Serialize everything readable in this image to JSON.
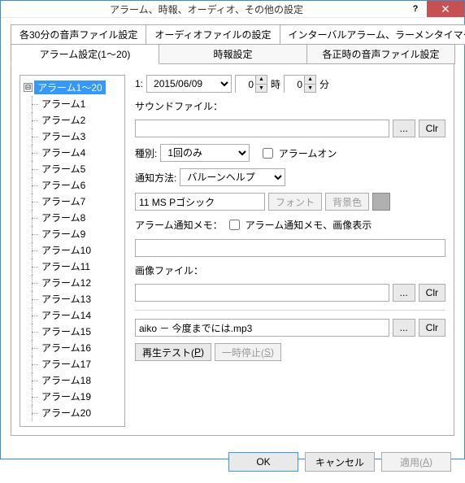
{
  "window": {
    "title": "アラーム、時報、オーディオ、その他の設定"
  },
  "titlebar": {
    "help": "?",
    "close": "✕"
  },
  "tabs_top": [
    "各30分の音声ファイル設定",
    "オーディオファイルの設定",
    "インターバルアラーム、ラーメンタイマー設定"
  ],
  "tabs_bot": [
    "アラーム設定(1～20)",
    "時報設定",
    "各正時の音声ファイル設定"
  ],
  "tree": {
    "root": "アラーム1～20",
    "expander": "⊟",
    "items": [
      "アラーム1",
      "アラーム2",
      "アラーム3",
      "アラーム4",
      "アラーム5",
      "アラーム6",
      "アラーム7",
      "アラーム8",
      "アラーム9",
      "アラーム10",
      "アラーム11",
      "アラーム12",
      "アラーム13",
      "アラーム14",
      "アラーム15",
      "アラーム16",
      "アラーム17",
      "アラーム18",
      "アラーム19",
      "アラーム20"
    ]
  },
  "form": {
    "index": "1:",
    "date": "2015/06/09",
    "hour": "0",
    "hour_unit": "時",
    "min": "0",
    "min_unit": "分",
    "soundfile_label": "サウンドファイル：",
    "soundfile_value": "",
    "browse": "...",
    "clr": "Clr",
    "type_label": "種別:",
    "type_value": "1回のみ",
    "alarm_on": "アラームオン",
    "notify_label": "通知方法:",
    "notify_value": "バルーンヘルプ",
    "font_text": "11 MS Pゴシック",
    "font_btn": "フォント",
    "bgcolor_btn": "背景色",
    "memo_label": "アラーム通知メモ：",
    "memo_cb": "アラーム通知メモ、画像表示",
    "memo_value": "",
    "image_label": "画像ファイル：",
    "image_value": "",
    "playfile": "aiko － 今度までには.mp3",
    "play_btn": "再生テスト(",
    "play_u": "P",
    "play_end": ")",
    "pause_btn": "一時停止(",
    "pause_u": "S",
    "pause_end": ")"
  },
  "footer": {
    "ok": "OK",
    "cancel": "キャンセル",
    "apply": "適用(",
    "apply_u": "A",
    "apply_end": ")"
  }
}
